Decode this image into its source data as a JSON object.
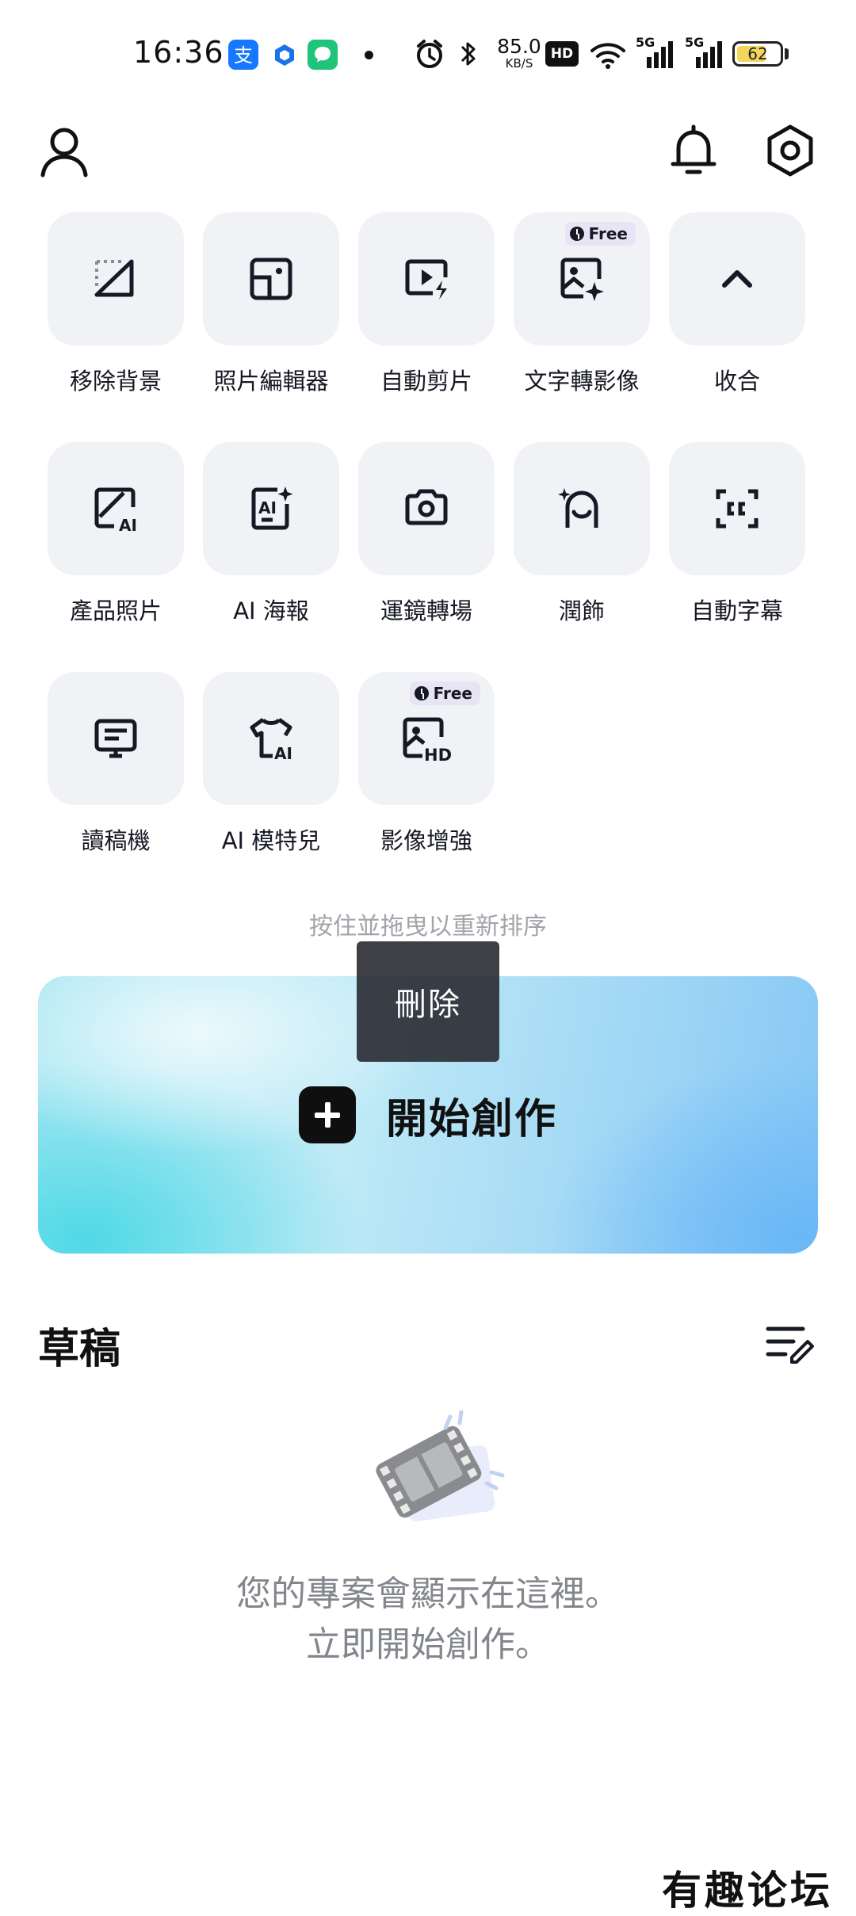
{
  "status_bar": {
    "time": "16:36",
    "net_speed_value": "85.0",
    "net_speed_unit": "KB/S",
    "hd_label": "HD",
    "signal_1": "5G",
    "signal_2": "5G",
    "battery": "62",
    "icons": [
      "alipay-icon",
      "cube-app-icon",
      "messaging-app-icon",
      "alarm-icon",
      "bluetooth-icon",
      "wifi-icon",
      "signal-icon"
    ]
  },
  "header": {
    "profile_icon": "person-icon",
    "notification_icon": "bell-icon",
    "settings_icon": "hexagon-gear-icon"
  },
  "tools": [
    {
      "label": "移除背景",
      "icon": "remove-background-icon"
    },
    {
      "label": "照片編輯器",
      "icon": "photo-editor-icon"
    },
    {
      "label": "自動剪片",
      "icon": "auto-cut-icon"
    },
    {
      "label": "文字轉影像",
      "icon": "text-to-image-icon",
      "badge": "Free"
    },
    {
      "label": "收合",
      "icon": "chevron-up-icon"
    },
    {
      "label": "產品照片",
      "icon": "product-photo-icon"
    },
    {
      "label": "AI 海報",
      "icon": "ai-poster-icon"
    },
    {
      "label": "運鏡轉場",
      "icon": "camera-icon"
    },
    {
      "label": "潤飾",
      "icon": "retouch-icon"
    },
    {
      "label": "自動字幕",
      "icon": "captions-icon"
    },
    {
      "label": "讀稿機",
      "icon": "teleprompter-icon"
    },
    {
      "label": "AI 模特兒",
      "icon": "ai-model-shirt-icon"
    },
    {
      "label": "影像增強",
      "icon": "image-enhance-hd-icon",
      "badge": "Free"
    }
  ],
  "reorder_hint": "按住並拖曳以重新排序",
  "tooltip": "刪除",
  "create_button": "開始創作",
  "drafts": {
    "title": "草稿",
    "edit_icon": "list-edit-icon",
    "empty_line1": "您的專案會顯示在這裡。",
    "empty_line2": "立即開始創作。"
  },
  "watermark": "有趣论坛",
  "colors": {
    "tile_bg": "#f0f2f5",
    "banner_cyan": "#4fd9e6",
    "banner_blue": "#6ab7f7",
    "free_badge_bg": "#e7e4f6",
    "hint_gray": "#a2a4a9"
  }
}
